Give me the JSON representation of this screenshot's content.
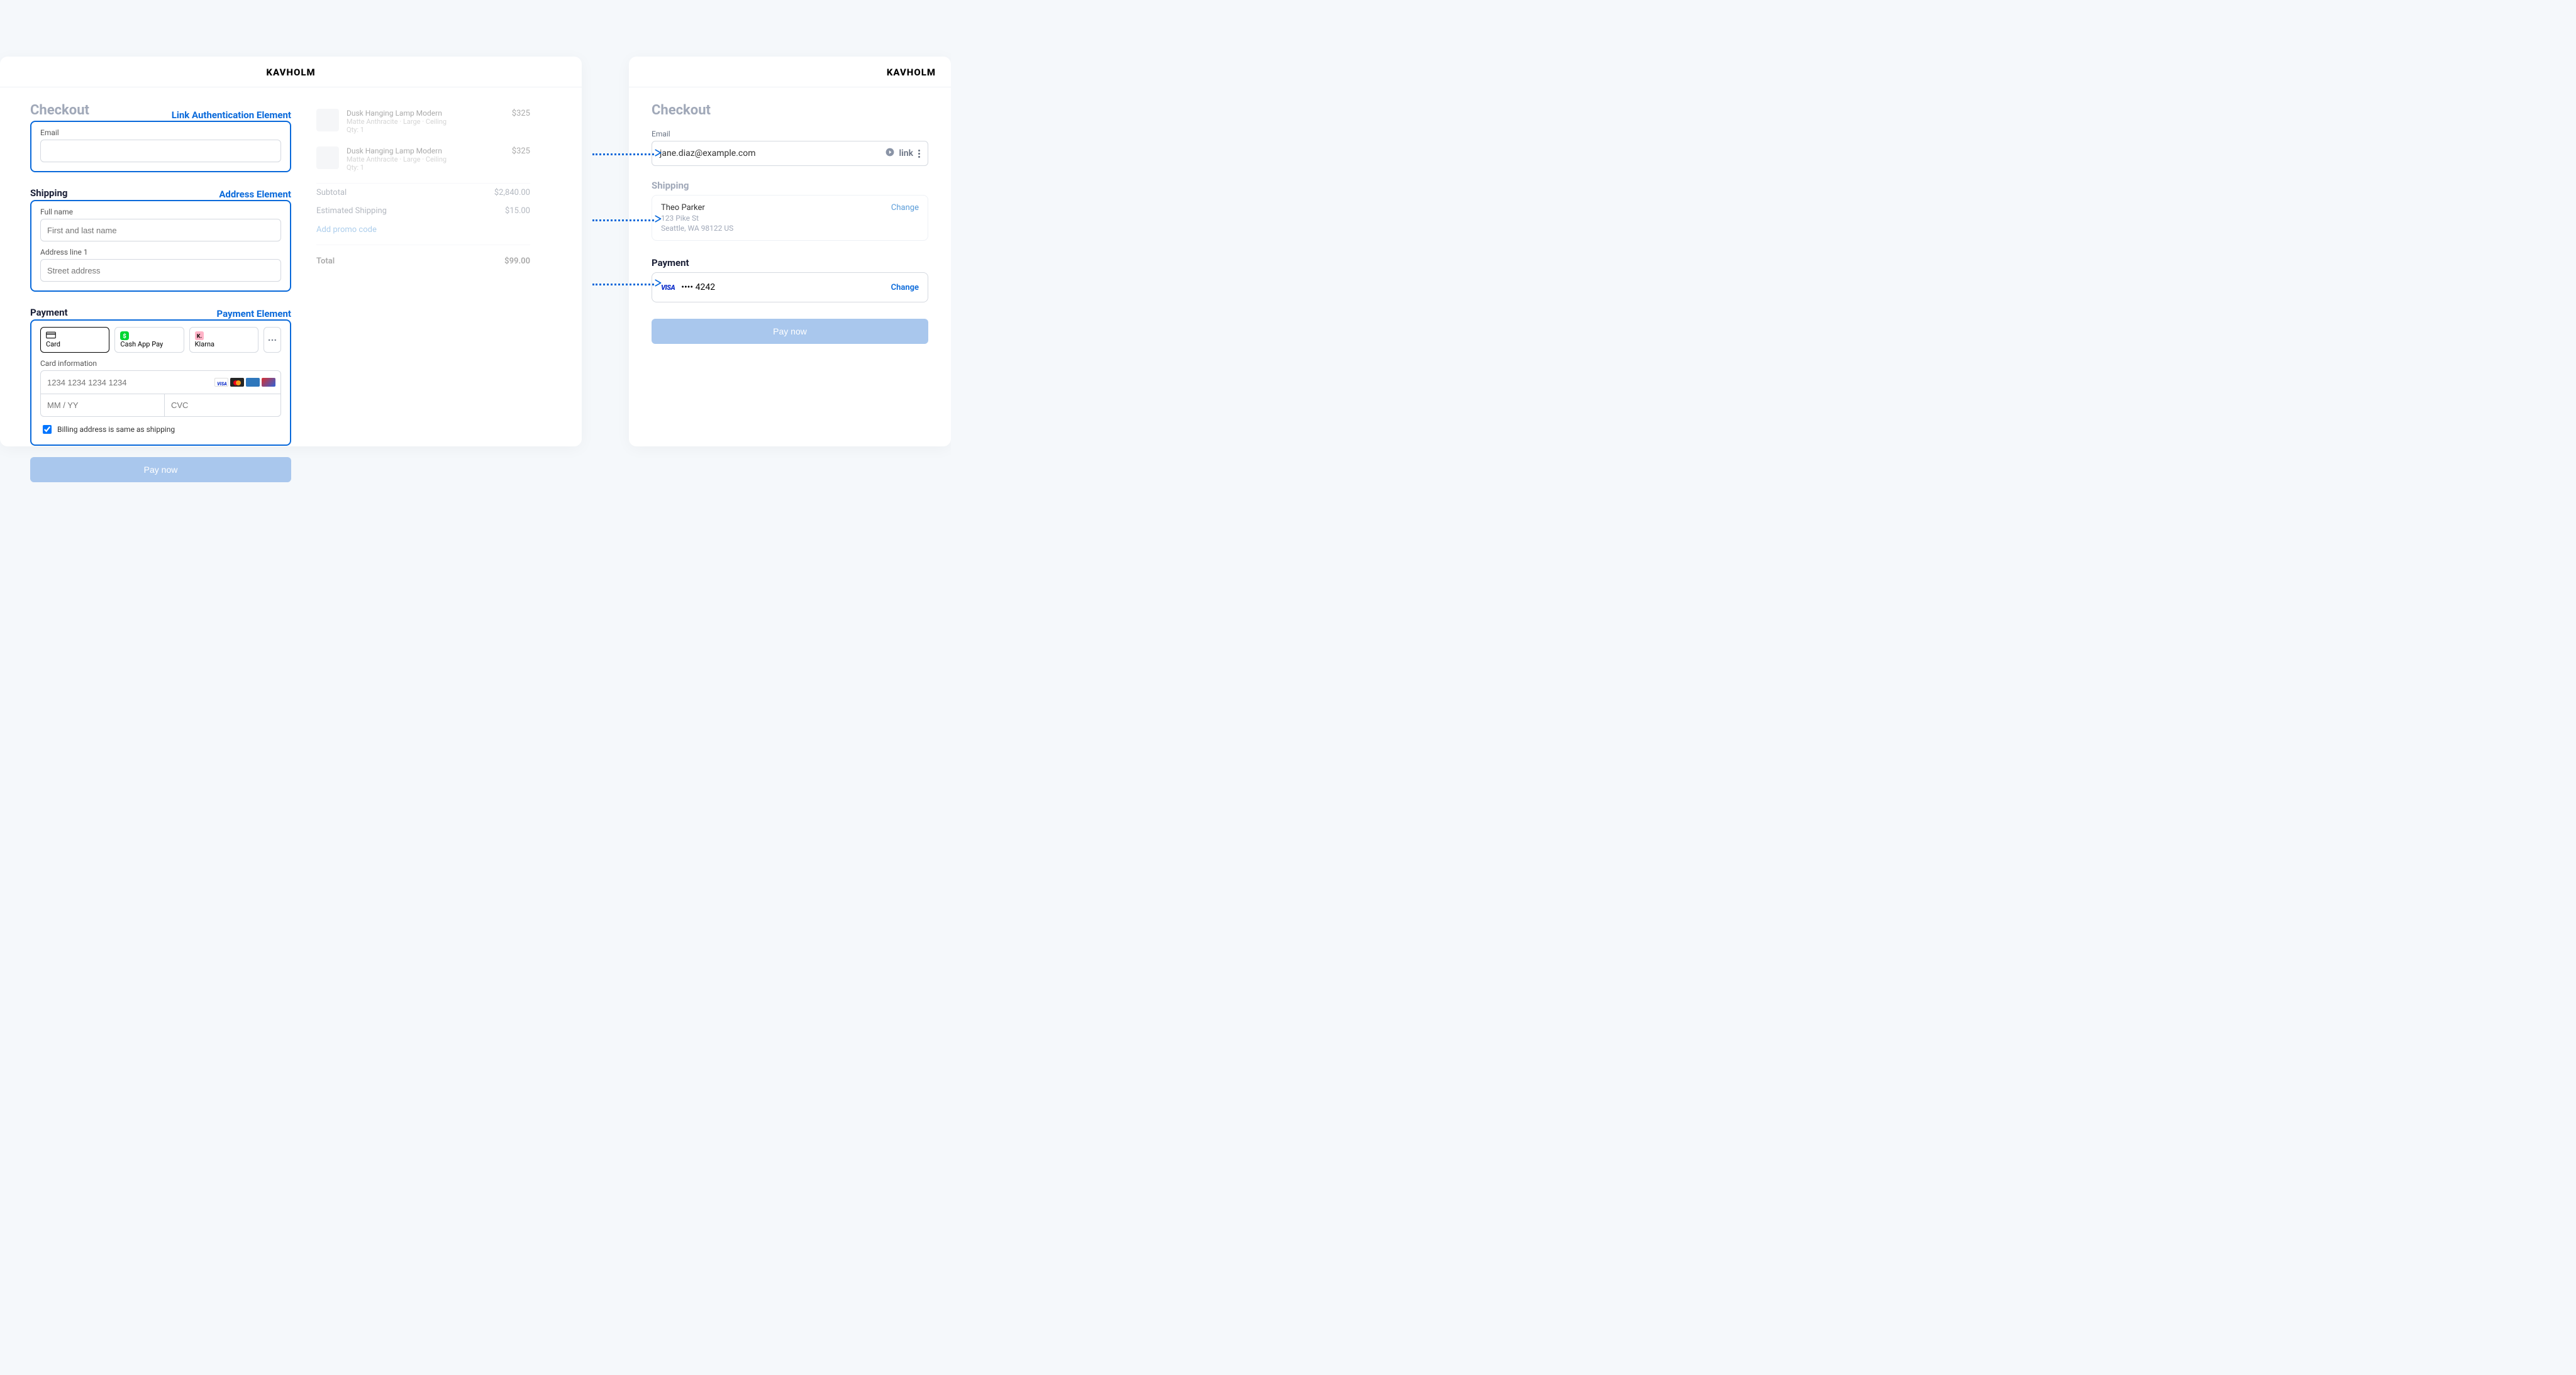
{
  "brand": "KAVHOLM",
  "left": {
    "title": "Checkout",
    "labels": {
      "link_auth": "Link Authentication Element",
      "address": "Address Element",
      "payment": "Payment Element"
    },
    "email_label": "Email",
    "shipping_heading": "Shipping",
    "fullname_label": "Full name",
    "fullname_placeholder": "First and last name",
    "addr1_label": "Address line 1",
    "addr1_placeholder": "Street address",
    "payment_heading": "Payment",
    "pm": {
      "card": "Card",
      "cashapp": "Cash App Pay",
      "klarna": "Klarna",
      "more": "···"
    },
    "card_info_label": "Card information",
    "cardnum_placeholder": "1234 1234 1234 1234",
    "exp_placeholder": "MM / YY",
    "cvc_placeholder": "CVC",
    "billing_same": "Billing address is same as shipping",
    "pay_button": "Pay now",
    "cart": {
      "items": [
        {
          "name": "Dusk Hanging Lamp Modern",
          "meta": "Matte Anthracite · Large · Ceiling",
          "qty": "Qty: 1",
          "price": "$325"
        },
        {
          "name": "Dusk Hanging Lamp Modern",
          "meta": "Matte Anthracite · Large · Ceiling",
          "qty": "Qty: 1",
          "price": "$325"
        }
      ],
      "subtotal_label": "Subtotal",
      "subtotal_value": "$2,840.00",
      "ship_label": "Estimated Shipping",
      "ship_value": "$15.00",
      "promo": "Add promo code",
      "total_label": "Total",
      "total_value": "$99.00"
    }
  },
  "right": {
    "title": "Checkout",
    "email_label": "Email",
    "email_value": "jane.diaz@example.com",
    "link_label": "link",
    "shipping_heading": "Shipping",
    "ship_name": "Theo Parker",
    "ship_addr1": "123 Pike St",
    "ship_addr2": "Seattle, WA 98122 US",
    "change": "Change",
    "payment_heading": "Payment",
    "card_brand": "VISA",
    "card_last4": "•••• 4242",
    "change2": "Change",
    "pay_button": "Pay now"
  }
}
